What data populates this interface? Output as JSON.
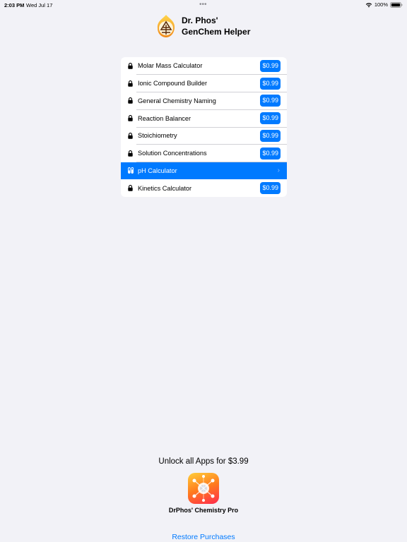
{
  "status": {
    "time": "2:03 PM",
    "date": "Wed Jul 17",
    "dots": "•••",
    "battery": "100%"
  },
  "header": {
    "title_line1": "Dr. Phos'",
    "title_line2": "GenChem Helper"
  },
  "apps": [
    {
      "name": "Molar Mass Calculator",
      "price": "$0.99",
      "locked": true
    },
    {
      "name": "Ionic Compound Builder",
      "price": "$0.99",
      "locked": true
    },
    {
      "name": "General Chemistry Naming",
      "price": "$0.99",
      "locked": true
    },
    {
      "name": "Reaction Balancer",
      "price": "$0.99",
      "locked": true
    },
    {
      "name": "Stoichiometry",
      "price": "$0.99",
      "locked": true
    },
    {
      "name": "Solution Concentrations",
      "price": "$0.99",
      "locked": true
    },
    {
      "name": "pH Calculator",
      "price": "",
      "locked": false,
      "selected": true,
      "chevron": "›"
    },
    {
      "name": "Kinetics Calculator",
      "price": "$0.99",
      "locked": true
    }
  ],
  "bundle": {
    "unlock_text": "Unlock all Apps for $3.99",
    "app_name": "DrPhos' Chemistry Pro",
    "restore_label": "Restore Purchases"
  },
  "colors": {
    "accent": "#007aff",
    "background": "#f2f2f7"
  }
}
